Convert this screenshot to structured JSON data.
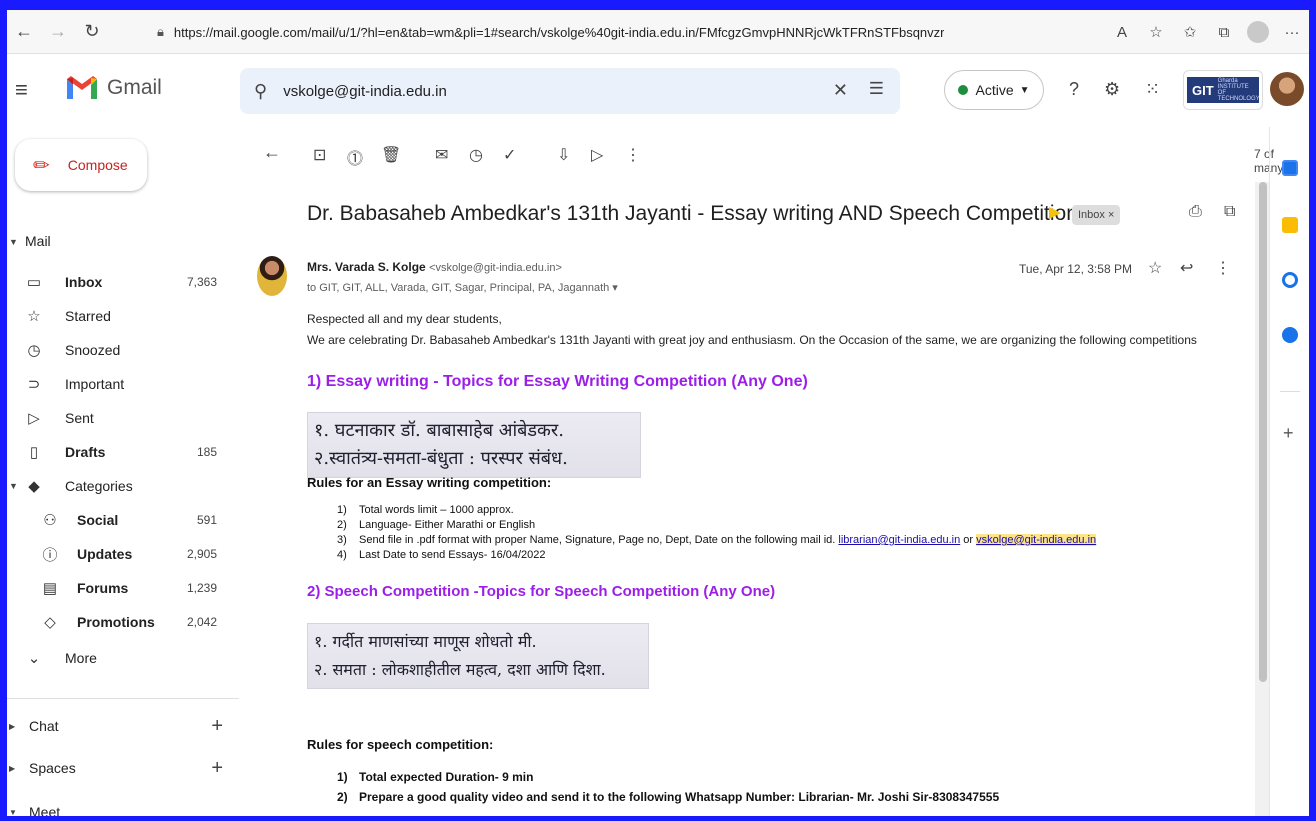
{
  "browser": {
    "url": "https://mail.google.com/mail/u/1/?hl=en&tab=wm&pli=1#search/vskolge%40git-india.edu.in/FMfcgzGmvpHNNRjcWkTFRnSTFbsqnvzr",
    "back_icon": "arrow-left-icon",
    "more_label": "···"
  },
  "header": {
    "app_name": "Gmail",
    "search_value": "vskolge@git-india.edu.in",
    "status": "Active",
    "org_logo_text": "GIT",
    "org_logo_small": "Gharda INSTITUTE OF TECHNOLOGY"
  },
  "sidebar": {
    "compose": "Compose",
    "mail_label": "Mail",
    "items": [
      {
        "label": "Inbox",
        "count": "7,363"
      },
      {
        "label": "Starred",
        "count": ""
      },
      {
        "label": "Snoozed",
        "count": ""
      },
      {
        "label": "Important",
        "count": ""
      },
      {
        "label": "Sent",
        "count": ""
      },
      {
        "label": "Drafts",
        "count": "185"
      },
      {
        "label": "Categories",
        "count": ""
      },
      {
        "label": "Social",
        "count": "591"
      },
      {
        "label": "Updates",
        "count": "2,905"
      },
      {
        "label": "Forums",
        "count": "1,239"
      },
      {
        "label": "Promotions",
        "count": "2,042"
      },
      {
        "label": "More",
        "count": ""
      }
    ],
    "sections": {
      "chat": "Chat",
      "spaces": "Spaces",
      "meet": "Meet"
    }
  },
  "toolbar": {
    "pager": "7 of many"
  },
  "message": {
    "subject": "Dr. Babasaheb Ambedkar's 131th Jayanti - Essay writing AND Speech Competition",
    "label_chip": "Inbox ×",
    "sender_name": "Mrs. Varada S. Kolge",
    "sender_email": "<vskolge@git-india.edu.in>",
    "recipients": "to GIT, GIT, ALL, Varada, GIT, Sagar, Principal, PA, Jagannath ▾",
    "date": "Tue, Apr 12, 3:58 PM",
    "greeting": "Respected all and my dear students,",
    "intro": " We are celebrating Dr. Babasaheb Ambedkar's 131th  Jayanti with great joy and enthusiasm. On the Occasion of the same, we are organizing the following competitions",
    "essay_heading": "1) Essay writing - Topics for Essay Writing Competition (Any One)",
    "essay_topics": [
      "१. घटनाकार डॉ. बाबासाहेब आंबेडकर.",
      "२.स्वातंत्र्य-समता-बंधुता : परस्पर संबंध."
    ],
    "essay_rules_heading": "Rules for an Essay writing competition:",
    "essay_rules": [
      {
        "num": "1)",
        "text": "Total words limit – 1000 approx."
      },
      {
        "num": "2)",
        "text": "Language- Either Marathi or English"
      },
      {
        "num": "3)",
        "text": "Send file in .pdf  format with proper Name, Signature, Page no, Dept, Date on the following mail id.",
        "link1": "librarian@git-india.edu.in",
        "or": " or ",
        "link2": "vskolge@git-india.edu.in"
      },
      {
        "num": "4)",
        "text": "Last Date to send Essays- 16/04/2022"
      }
    ],
    "speech_heading": "2) Speech Competition -Topics for Speech Competition (Any One)",
    "speech_topics": [
      "१. गर्दीत माणसांच्या माणूस शोधतो मी.",
      "२. समता : लोकशाहीतील महत्व, दशा आणि दिशा."
    ],
    "speech_rules_heading": "Rules for speech competition:",
    "speech_rules": [
      {
        "num": "1)",
        "text": "Total expected Duration- 9 min"
      },
      {
        "num": "2)",
        "text": "Prepare a good quality video and send it to the following Whatsapp Number: Librarian- Mr. Joshi Sir-8308347555"
      }
    ]
  },
  "colors": {
    "accent_purple": "#9b1fe8",
    "compose_red": "#c5221f",
    "search_bg": "#eaf1fb",
    "active_green": "#1e8e3e"
  }
}
